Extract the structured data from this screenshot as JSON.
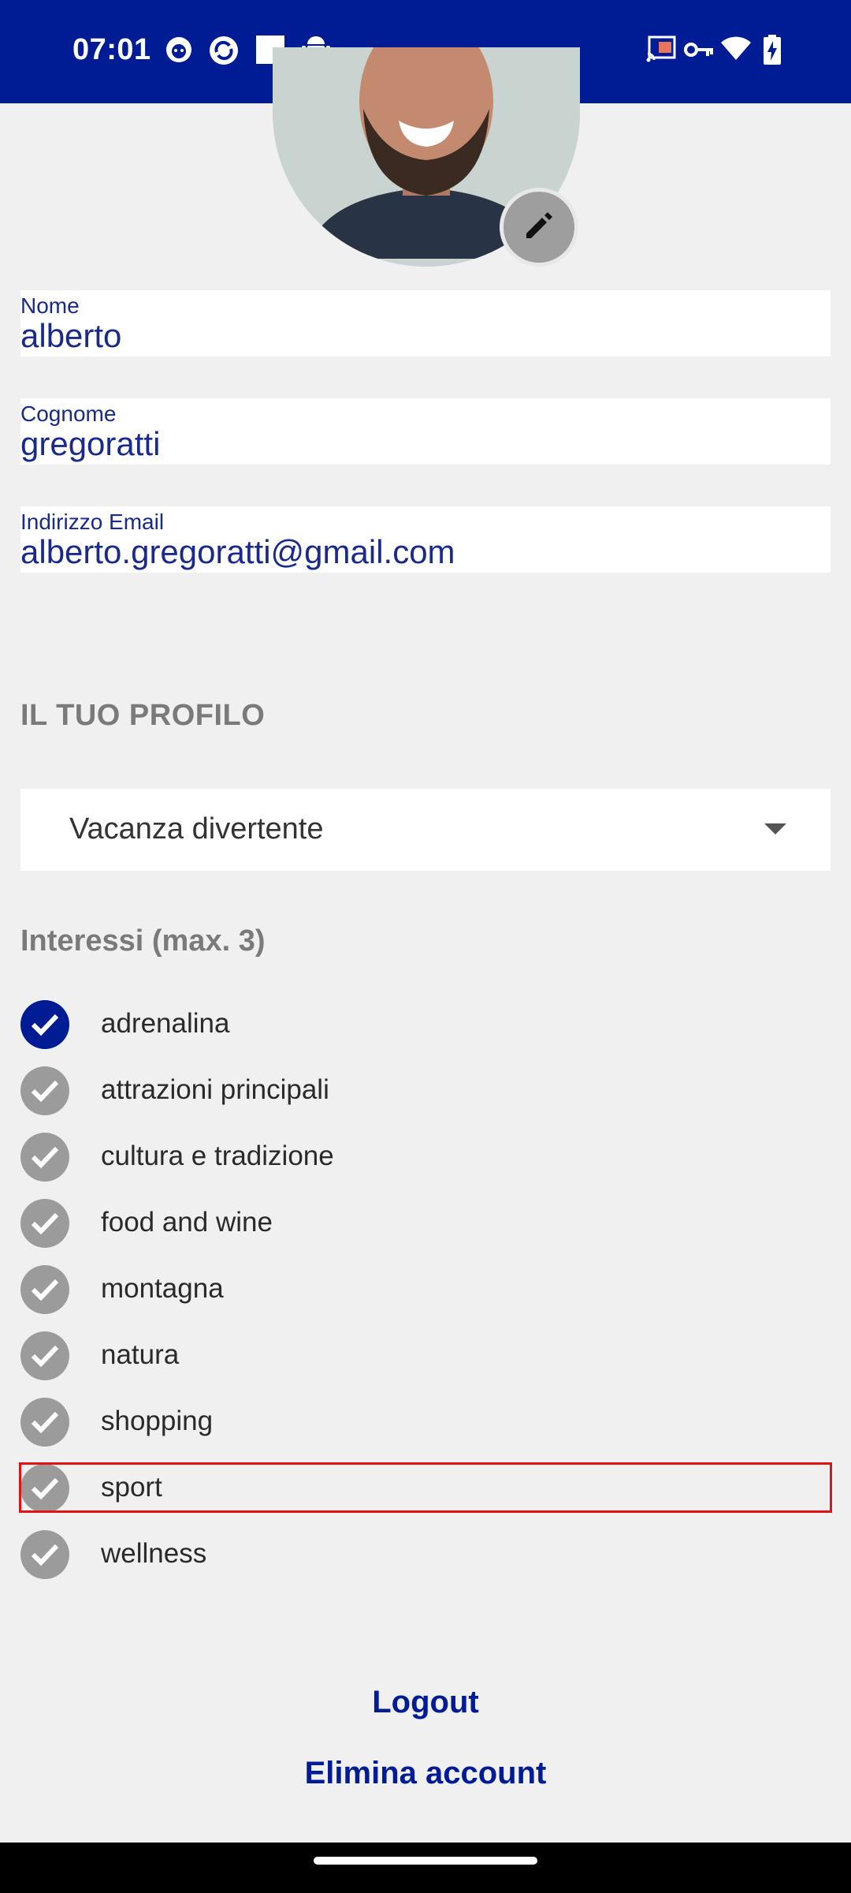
{
  "status_bar": {
    "time": "07:01",
    "colors": {
      "background": "#001c94"
    },
    "left_icons": [
      "cat-notification-icon",
      "sync-icon",
      "stop-square-icon",
      "android-icon",
      "dot-icon"
    ],
    "right_icons": [
      "cast-icon",
      "vpn-key-icon",
      "wifi-icon",
      "battery-charging-icon"
    ]
  },
  "profile": {
    "fields": [
      {
        "label": "Nome",
        "value": "alberto"
      },
      {
        "label": "Cognome",
        "value": "gregoratti"
      },
      {
        "label": "Indirizzo Email",
        "value": "alberto.gregoratti@gmail.com"
      }
    ],
    "section_title": "IL TUO PROFILO",
    "profile_type": {
      "selected": "Vacanza divertente"
    },
    "interests_title": "Interessi (max. 3)",
    "interests": [
      {
        "label": "adrenalina",
        "checked": true
      },
      {
        "label": "attrazioni principali",
        "checked": false
      },
      {
        "label": "cultura e tradizione",
        "checked": false
      },
      {
        "label": "food and wine",
        "checked": false
      },
      {
        "label": "montagna",
        "checked": false
      },
      {
        "label": "natura",
        "checked": false
      },
      {
        "label": "shopping",
        "checked": false
      },
      {
        "label": "sport",
        "checked": false
      },
      {
        "label": "wellness",
        "checked": false
      }
    ],
    "highlighted_interest": "sport"
  },
  "actions": {
    "logout": "Logout",
    "delete_account": "Elimina account"
  },
  "colors": {
    "accent": "#001c94",
    "unchecked": "#9b9b9b",
    "highlight": "#e01414"
  }
}
